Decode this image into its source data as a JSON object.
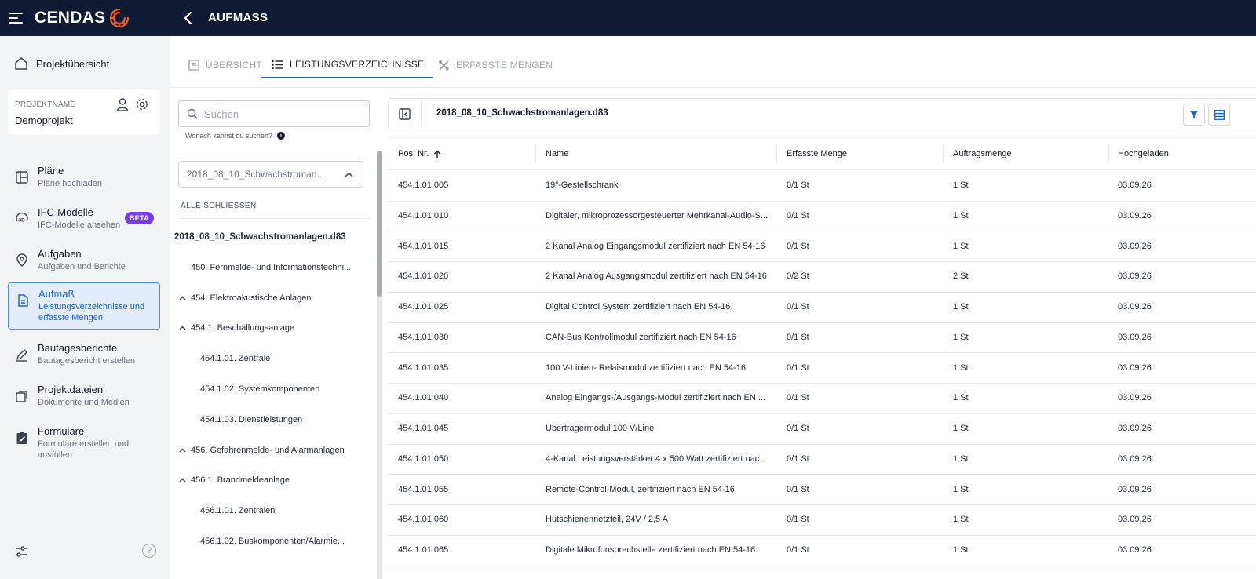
{
  "topbar": {
    "brand": "CENDAS",
    "title": "AUFMASS"
  },
  "sidebar": {
    "home_label": "Projektübersicht",
    "project": {
      "label": "PROJEKTNAME",
      "value": "Demoprojekt"
    },
    "items": [
      {
        "title": "Pläne",
        "subtitle": "Pläne hochladen",
        "icon": "plans-icon"
      },
      {
        "title": "IFC-Modelle",
        "subtitle": "IFC-Modelle ansehen",
        "badge": "BETA",
        "icon": "3d-icon"
      },
      {
        "title": "Aufgaben",
        "subtitle": "Aufgaben und Berichte",
        "icon": "location-pin-icon"
      },
      {
        "title": "Aufmaß",
        "subtitle": "Leistungsverzeichnisse und erfasste Mengen",
        "icon": "document-icon",
        "active": true
      },
      {
        "title": "Bautagesberichte",
        "subtitle": "Bautagesbericht erstellen",
        "icon": "pencil-icon"
      },
      {
        "title": "Projektdateien",
        "subtitle": "Dokumente und Medien",
        "icon": "files-icon"
      },
      {
        "title": "Formulare",
        "subtitle": "Formulare erstellen und ausfüllen",
        "icon": "clipboard-check-icon"
      }
    ],
    "help_label": "?"
  },
  "tabs": [
    {
      "label": "ÜBERSICHT",
      "icon": "overview-icon"
    },
    {
      "label": "LEISTUNGSVERZEICHNISSE",
      "icon": "list-icon",
      "active": true
    },
    {
      "label": "ERFASSTE MENGEN",
      "icon": "tools-icon"
    }
  ],
  "tree": {
    "search_placeholder": "Suchen",
    "search_hint": "Wonach kannst du suchen?",
    "file_select_value": "2018_08_10_Schwachstroman...",
    "close_all_label": "ALLE SCHLIESSEN",
    "rows": [
      {
        "label": "2018_08_10_Schwachstromanlagen.d83",
        "level": 0,
        "expander": ""
      },
      {
        "label": "450. Fernmelde- und Informationstechni...",
        "level": 1,
        "expander": ""
      },
      {
        "label": "454. Elektroakustische Anlagen",
        "level": 1,
        "expander": "^"
      },
      {
        "label": "454.1. Beschallungsanlage",
        "level": 2,
        "expander": "^"
      },
      {
        "label": "454.1.01. Zentrale",
        "level": 3,
        "expander": ""
      },
      {
        "label": "454.1.02. Systemkomponenten",
        "level": 3,
        "expander": ""
      },
      {
        "label": "454.1.03. Dienstleistungen",
        "level": 3,
        "expander": ""
      },
      {
        "label": "456. Gefahrenmelde- und Alarmanlagen",
        "level": 1,
        "expander": "^"
      },
      {
        "label": "456.1. Brandmeldeanlage",
        "level": 2,
        "expander": "^"
      },
      {
        "label": "456.1.01. Zentralen",
        "level": 3,
        "expander": ""
      },
      {
        "label": "456.1.02. Buskomponenten/Alarmie...",
        "level": 3,
        "expander": ""
      }
    ]
  },
  "table": {
    "file_name": "2018_08_10_Schwachstromanlagen.d83",
    "columns": [
      "Pos. Nr.",
      "Name",
      "Erfasste Menge",
      "Auftragsmenge",
      "Hochgeladen"
    ],
    "rows": [
      [
        "454.1.01.005",
        "19\"-Gestellschrank",
        "0/1 St",
        "1 St",
        "03.09.26"
      ],
      [
        "454.1.01.010",
        "Digitaler, mikroprozessorgesteuerter Mehrkanal-Audio-S...",
        "0/1 St",
        "1 St",
        "03.09.26"
      ],
      [
        "454.1.01.015",
        "2 Kanal Analog Eingangsmodul zertifiziert nach EN 54-16",
        "0/1 St",
        "1 St",
        "03.09.26"
      ],
      [
        "454.1.01.020",
        "2 Kanal Analog Ausgangsmodul zertifiziert nach EN 54-16",
        "0/2 St",
        "2 St",
        "03.09.26"
      ],
      [
        "454.1.01.025",
        "Digital Control System zertifiziert nach EN 54-16",
        "0/1 St",
        "1 St",
        "03.09.26"
      ],
      [
        "454.1.01.030",
        "CAN-Bus Kontrollmodul zertifiziert nach EN 54-16",
        "0/1 St",
        "1 St",
        "03.09.26"
      ],
      [
        "454.1.01.035",
        "100 V-Linien- Relaismodul zertifiziert nach EN 54-16",
        "0/1 St",
        "1 St",
        "03.09.26"
      ],
      [
        "454.1.01.040",
        "Analog Eingangs-/Ausgangs-Modul zertifiziert nach EN ...",
        "0/1 St",
        "1 St",
        "03.09.26"
      ],
      [
        "454.1.01.045",
        "Übertragermodul 100 V/Line",
        "0/1 St",
        "1 St",
        "03.09.26"
      ],
      [
        "454.1.01.050",
        "4-Kanal Leistungsverstärker 4 x 500 Watt zertifiziert nac...",
        "0/1 St",
        "1 St",
        "03.09.26"
      ],
      [
        "454.1.01.055",
        "Remote-Control-Modul, zertifiziert nach EN 54-16",
        "0/1 St",
        "1 St",
        "03.09.26"
      ],
      [
        "454.1.01.060",
        "Hutschienennetzteil, 24V / 2,5 A",
        "0/1 St",
        "1 St",
        "03.09.26"
      ],
      [
        "454.1.01.065",
        "Digitale Mikrofonsprechstelle zertifiziert nach EN 54-16",
        "0/1 St",
        "1 St",
        "03.09.26"
      ]
    ]
  },
  "colors": {
    "topbar": "#0f1b33",
    "accent": "#1e63c7",
    "brand_orange": "#f05a28",
    "beta": "#7c3aed"
  }
}
